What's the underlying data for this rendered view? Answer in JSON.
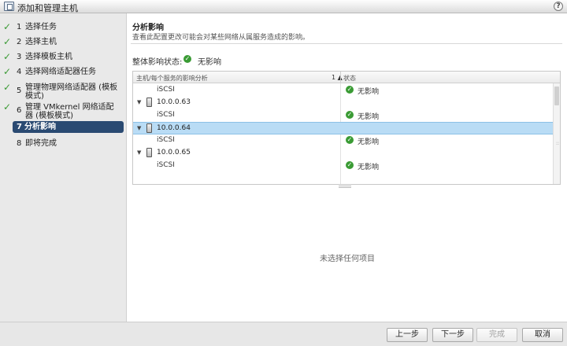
{
  "window": {
    "title": "添加和管理主机",
    "help": "?"
  },
  "steps": [
    {
      "num": "1",
      "label": "选择任务",
      "done": true
    },
    {
      "num": "2",
      "label": "选择主机",
      "done": true
    },
    {
      "num": "3",
      "label": "选择模板主机",
      "done": true
    },
    {
      "num": "4",
      "label": "选择网络适配器任务",
      "done": true
    },
    {
      "num": "5",
      "label": "管理物理网络适配器 (模板模式)",
      "done": true
    },
    {
      "num": "6",
      "label": "管理 VMkernel 网络适配器 (模板模式)",
      "done": true
    },
    {
      "num": "7",
      "label": "分析影响",
      "done": false,
      "active": true
    },
    {
      "num": "8",
      "label": "即将完成",
      "done": false
    }
  ],
  "main": {
    "title": "分析影响",
    "description": "查看此配置更改可能会对某些网络从属服务造成的影响。",
    "overall_label": "整体影响状态:",
    "overall_value": "无影响",
    "empty_message": "未选择任何项目"
  },
  "grid": {
    "col1": "主机/每个服务的影响分析",
    "sort_indicator": "1 ▲",
    "col2": "状态",
    "rows": [
      {
        "type": "service",
        "name": "iSCSI",
        "status": "无影响"
      },
      {
        "type": "host",
        "name": "10.0.0.63"
      },
      {
        "type": "service",
        "name": "iSCSI",
        "status": "无影响"
      },
      {
        "type": "host",
        "name": "10.0.0.64",
        "selected": true
      },
      {
        "type": "service",
        "name": "iSCSI",
        "status": "无影响"
      },
      {
        "type": "host",
        "name": "10.0.0.65"
      },
      {
        "type": "service",
        "name": "iSCSI",
        "status": "无影响"
      }
    ]
  },
  "footer": {
    "back": "上一步",
    "next": "下一步",
    "finish": "完成",
    "cancel": "取消"
  },
  "colors": {
    "accent": "#2a4a72",
    "selected_row": "#b9dcf5",
    "ok": "#3a9b34"
  }
}
